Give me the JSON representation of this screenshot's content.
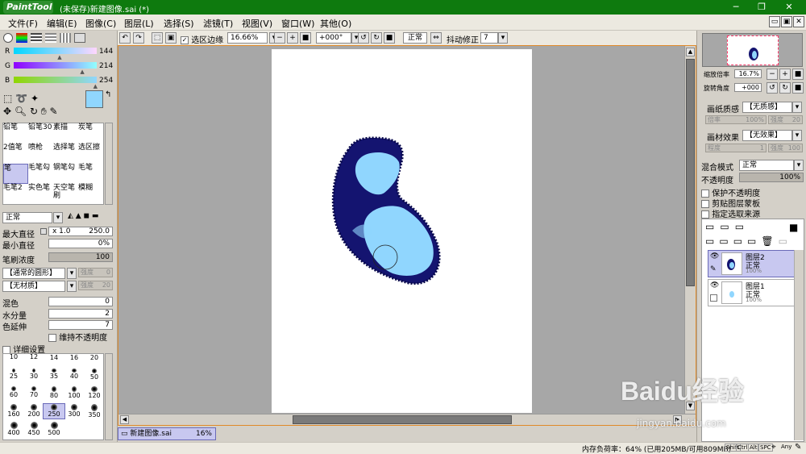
{
  "app": {
    "logo_text": "PaintTool SAI",
    "window_title": "(未保存)新建图像.sai (*)",
    "min_icon": "─",
    "max_icon": "❐",
    "close_icon": "✕"
  },
  "menu": [
    "文件(F)",
    "编辑(E)",
    "图像(C)",
    "图层(L)",
    "选择(S)",
    "滤镜(T)",
    "视图(V)",
    "窗口(W)",
    "其他(O)"
  ],
  "mdi": {
    "min": "▭",
    "restore": "▣",
    "close": "✕"
  },
  "toolbar": {
    "sel_edge_label": "选区边缘",
    "zoom": "16.66%",
    "angle": "+000°",
    "blend": "正常",
    "stabilizer_label": "抖动修正",
    "stabilizer_value": "7"
  },
  "colors": {
    "r_label": "R",
    "r_value": "144",
    "g_label": "G",
    "g_value": "214",
    "b_label": "B",
    "b_value": "254",
    "primary": "#90d6fe",
    "r_pos": 0.565,
    "g_pos": 0.839,
    "b_pos": 0.996
  },
  "tools": [
    {
      "label": "铅笔"
    },
    {
      "label": "铅笔30"
    },
    {
      "label": "素描"
    },
    {
      "label": "炭笔"
    },
    {
      "label": "2值笔"
    },
    {
      "label": "喷枪"
    },
    {
      "label": "选择笔"
    },
    {
      "label": "选区擦"
    },
    {
      "label": "笔"
    },
    {
      "label": "毛笔勾"
    },
    {
      "label": "钢笔勾"
    },
    {
      "label": "毛笔"
    },
    {
      "label": "毛笔2"
    },
    {
      "label": "实色笔"
    },
    {
      "label": "天空笔刷"
    },
    {
      "label": "模糊"
    }
  ],
  "brush": {
    "mode": "正常",
    "max_diam_label": "最大直径",
    "max_diam_mult": "x 1.0",
    "max_diam_value": "250.0",
    "min_diam_label": "最小直径",
    "min_diam_value": "0%",
    "density_label": "笔刷浓度",
    "density_value": "100",
    "shape": "【通常的圆形】",
    "shape_strength_label": "强度",
    "shape_strength": "0",
    "texture": "【无材质】",
    "texture_strength_label": "强度",
    "texture_strength": "20",
    "blend_label": "混色",
    "blend_value": "0",
    "water_label": "水分量",
    "water_value": "2",
    "extend_label": "色延伸",
    "extend_value": "7",
    "keep_opacity_label": "维持不透明度",
    "detail_label": "详细设置"
  },
  "brush_sizes": [
    "10",
    "12",
    "14",
    "16",
    "20",
    "25",
    "30",
    "35",
    "40",
    "50",
    "60",
    "70",
    "80",
    "100",
    "120",
    "160",
    "200",
    "250",
    "300",
    "350",
    "400",
    "450",
    "500"
  ],
  "navigator": {
    "zoom_label": "缩放倍率",
    "zoom_value": "16.7%",
    "rotate_label": "旋转角度",
    "rotate_value": "+000"
  },
  "paper": {
    "paper_tex_label": "画纸质感",
    "paper_tex_value": "【无质感】",
    "paper_tex_sub": "倍率",
    "paper_tex_sub_val": "100%",
    "paper_tex_sub2": "强度",
    "paper_tex_sub2_val": "20",
    "effect_label": "画材效果",
    "effect_value": "【无效果】",
    "effect_sub": "程度",
    "effect_sub_val": "1",
    "effect_sub2": "强度",
    "effect_sub2_val": "100"
  },
  "layer_panel": {
    "blend_label": "混合模式",
    "blend_value": "正常",
    "opacity_label": "不透明度",
    "opacity_value": "100%",
    "protect_opacity": "保护不透明度",
    "clip_group": "剪贴图层蒙板",
    "sel_source": "指定选取来源"
  },
  "layers": [
    {
      "name": "图层2",
      "mode": "正常",
      "opacity": "100%"
    },
    {
      "name": "图层1",
      "mode": "正常",
      "opacity": "100%"
    }
  ],
  "tab": {
    "name": "新建图像.sai",
    "zoom": "16%"
  },
  "status": {
    "memory": "内存负荷率：64% (已用205MB/可用809MB)",
    "keys": [
      "Shift",
      "Ctrl",
      "Alt",
      "SPC"
    ],
    "any": "Any"
  },
  "watermark": {
    "brand": "Baidu经验",
    "url": "jingyan.baidu.com"
  }
}
